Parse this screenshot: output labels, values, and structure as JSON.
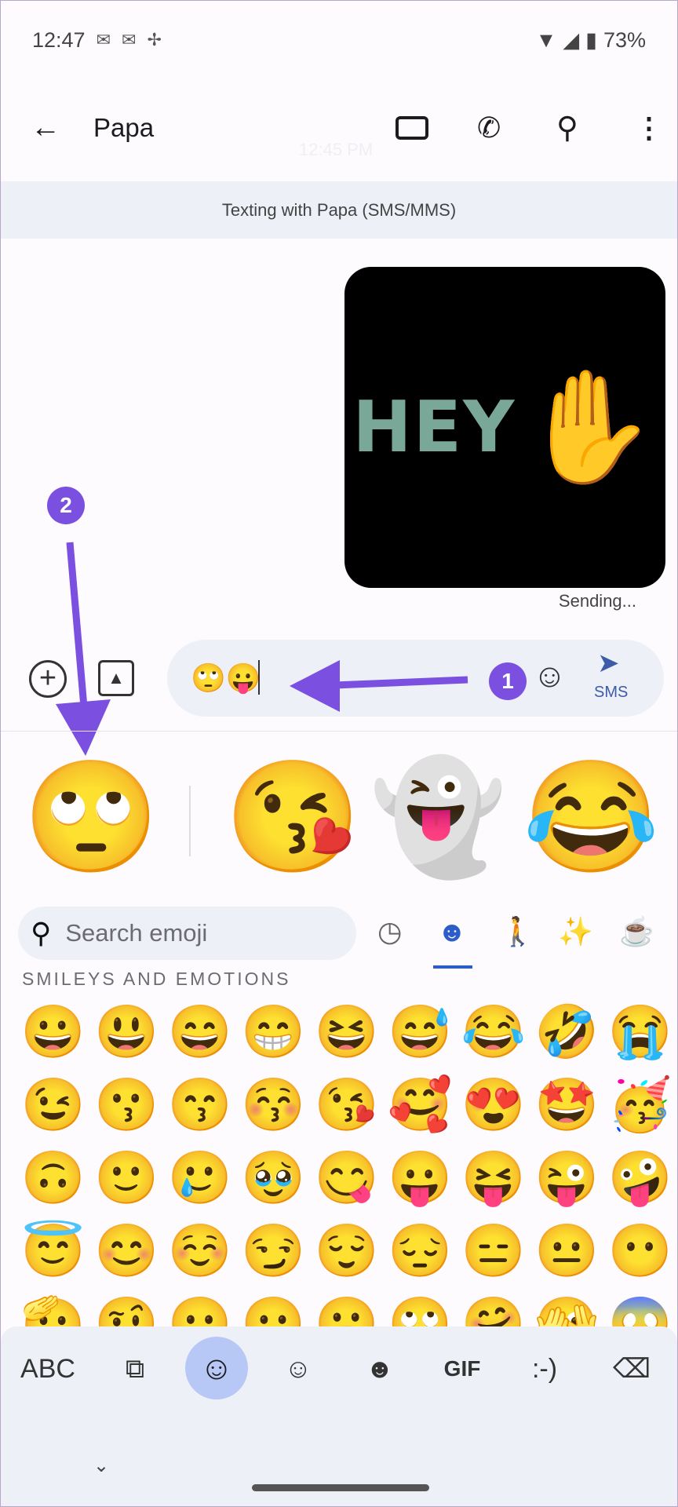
{
  "status_bar": {
    "time": "12:47",
    "notification_icons": [
      "outlook-icon",
      "outlook-icon",
      "pinwheel-icon"
    ],
    "battery": "73%"
  },
  "header": {
    "title": "Papa",
    "faded_timestamp": "12:45 PM"
  },
  "banner": "Texting with Papa (SMS/MMS)",
  "message": {
    "sticker_text": "HEY",
    "status": "Sending..."
  },
  "compose": {
    "value": "🙄😛",
    "send_label": "SMS"
  },
  "annotations": {
    "badge1": "1",
    "badge2": "2",
    "accent": "#7b4fe0"
  },
  "suggestions": [
    "🙄",
    "😘",
    "👻",
    "😂"
  ],
  "emoji_panel": {
    "search_placeholder": "Search emoji",
    "categories": [
      "recent",
      "smileys",
      "people",
      "activities",
      "food"
    ],
    "active_category": "smileys",
    "section_title": "SMILEYS AND EMOTIONS",
    "emojis": [
      "😀",
      "😃",
      "😄",
      "😁",
      "😆",
      "😅",
      "😂",
      "🤣",
      "😭",
      "😉",
      "😗",
      "😙",
      "😚",
      "😘",
      "🥰",
      "😍",
      "🤩",
      "🥳",
      "🙃",
      "🙂",
      "🥲",
      "🥹",
      "😋",
      "😛",
      "😝",
      "😜",
      "🤪",
      "😇",
      "😊",
      "☺️",
      "😏",
      "😌",
      "😔",
      "😑",
      "😐",
      "😶",
      "🫡",
      "🤨",
      "😶",
      "😐",
      "😬",
      "🙄",
      "🤗",
      "🫣",
      "😱"
    ]
  },
  "keyboard_bar": {
    "abc": "ABC",
    "gif": "GIF",
    "emoticon": ":-)"
  }
}
